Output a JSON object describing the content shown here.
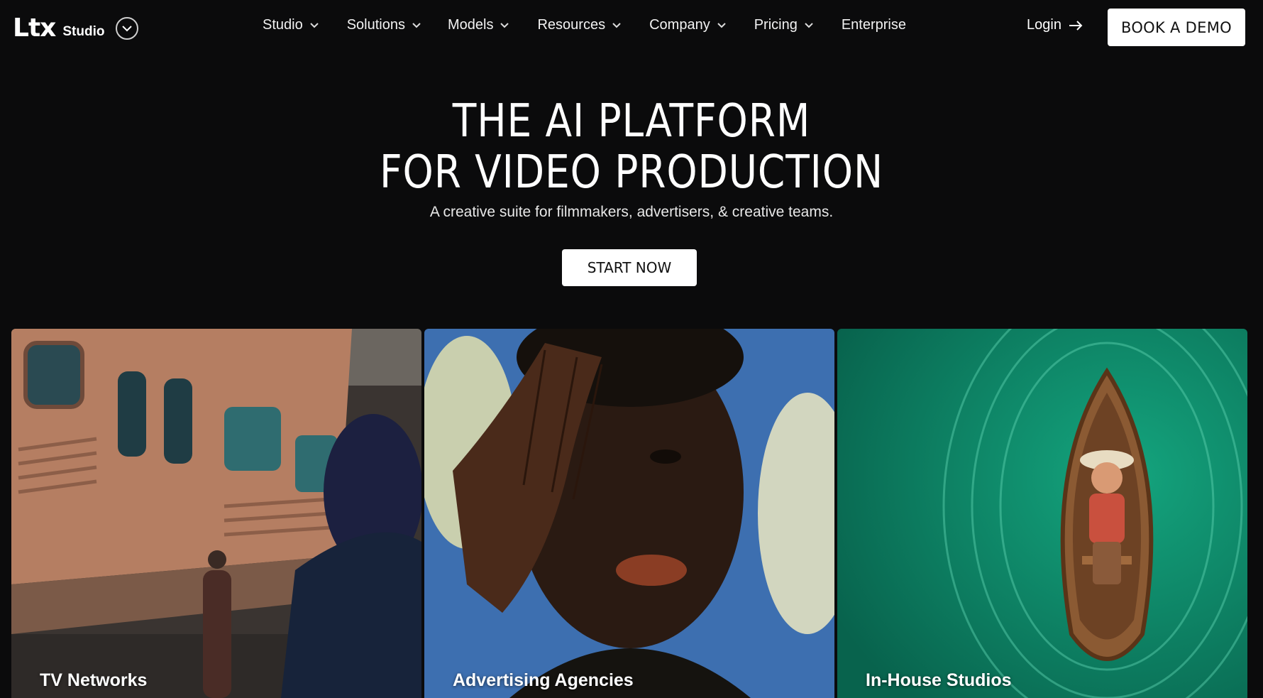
{
  "brand": {
    "logo": "Ltx",
    "sub": "Studio"
  },
  "nav": {
    "items": [
      {
        "label": "Studio",
        "dropdown": true
      },
      {
        "label": "Solutions",
        "dropdown": true
      },
      {
        "label": "Models",
        "dropdown": true
      },
      {
        "label": "Resources",
        "dropdown": true
      },
      {
        "label": "Company",
        "dropdown": true
      },
      {
        "label": "Pricing",
        "dropdown": true
      },
      {
        "label": "Enterprise",
        "dropdown": false
      }
    ],
    "login": "Login",
    "demo": "BOOK A DEMO"
  },
  "hero": {
    "title_line1": "THE AI PLATFORM",
    "title_line2": "FOR VIDEO PRODUCTION",
    "subtitle": "A creative suite for filmmakers, advertisers, & creative teams.",
    "cta": "START NOW"
  },
  "cards": [
    {
      "label": "TV Networks"
    },
    {
      "label": "Advertising Agencies"
    },
    {
      "label": "In-House Studios"
    }
  ],
  "colors": {
    "background": "#0b0b0c",
    "button_bg": "#ffffff",
    "card_green": "#0e8a6a",
    "card_blue": "#3d6fb0"
  }
}
